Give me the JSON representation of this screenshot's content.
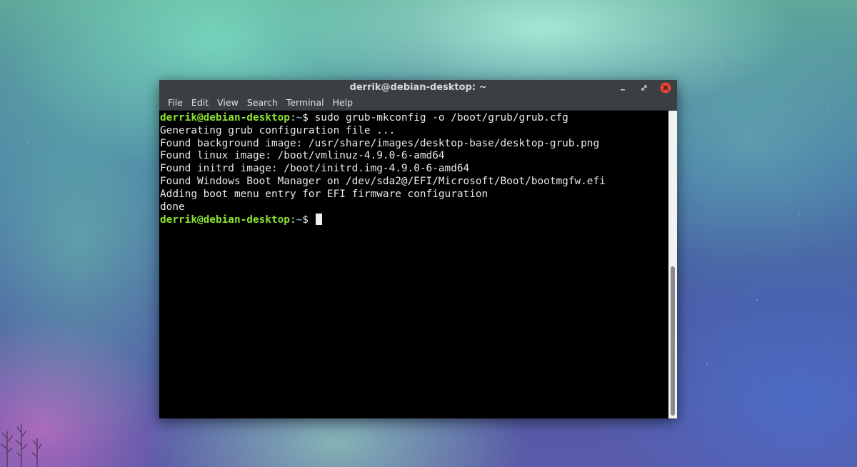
{
  "window": {
    "title": "derrik@debian-desktop: ~",
    "controls": {
      "minimize_icon": "minimize-icon",
      "restore_icon": "restore-icon",
      "close_icon": "close-icon"
    }
  },
  "menubar": {
    "items": [
      "File",
      "Edit",
      "View",
      "Search",
      "Terminal",
      "Help"
    ]
  },
  "terminal": {
    "prompt_user": "derrik@debian-desktop",
    "prompt_sep": ":",
    "prompt_path": "~",
    "prompt_symbol": "$ ",
    "command": "sudo grub-mkconfig -o /boot/grub/grub.cfg",
    "output": [
      "Generating grub configuration file ...",
      "Found background image: /usr/share/images/desktop-base/desktop-grub.png",
      "Found linux image: /boot/vmlinuz-4.9.0-6-amd64",
      "Found initrd image: /boot/initrd.img-4.9.0-6-amd64",
      "Found Windows Boot Manager on /dev/sda2@/EFI/Microsoft/Boot/bootmgfw.efi",
      "Adding boot menu entry for EFI firmware configuration",
      "done"
    ]
  },
  "colors": {
    "prompt_user": "#8ae234",
    "prompt_path": "#729fcf",
    "close_button": "#e0453a",
    "titlebar": "#3c3f41"
  }
}
